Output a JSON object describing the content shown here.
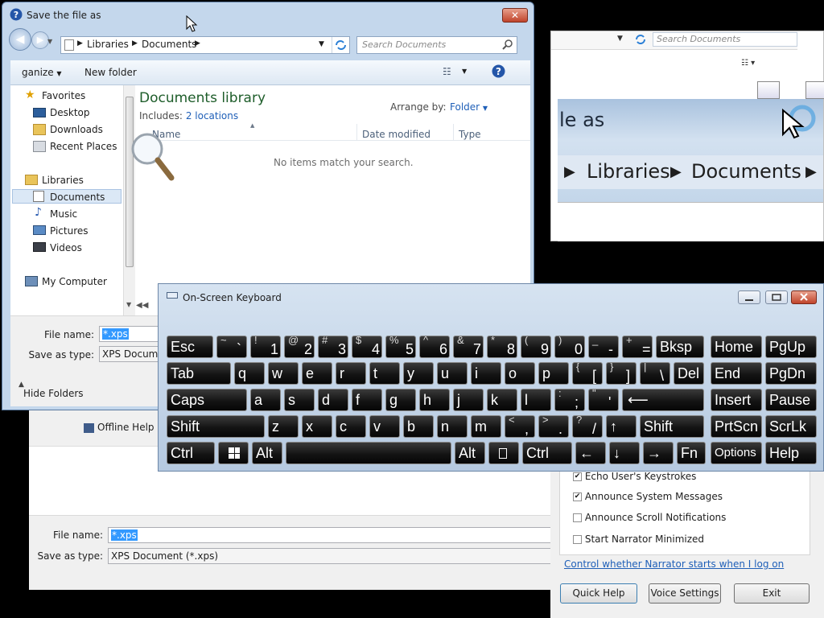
{
  "back_dialog": {
    "offline_help": "Offline Help",
    "file_name_label": "File name:",
    "file_name_value": "*.xps",
    "save_type_label": "Save as type:",
    "save_type_value": "XPS Document (*.xps)"
  },
  "magnifier": {
    "search_placeholder": "Search Documents",
    "zoom_title": "le as",
    "zoom_crumb1": "Libraries",
    "zoom_crumb2": "Documents"
  },
  "narrator": {
    "checkboxes": [
      {
        "label": "Echo User's Keystrokes",
        "checked": true
      },
      {
        "label": "Announce System Messages",
        "checked": true
      },
      {
        "label": "Announce Scroll Notifications",
        "checked": false
      },
      {
        "label": "Start Narrator Minimized",
        "checked": false
      }
    ],
    "link": "Control whether Narrator starts when I log on",
    "quick_help": "Quick Help",
    "voice_settings": "Voice Settings",
    "exit": "Exit"
  },
  "save_dialog": {
    "title": "Save the file as",
    "breadcrumb": [
      "Libraries",
      "Documents"
    ],
    "search_placeholder": "Search Documents",
    "organize": "ganize",
    "new_folder": "New folder",
    "nav": {
      "favorites": "Favorites",
      "desktop": "Desktop",
      "downloads": "Downloads",
      "recent": "Recent Places",
      "libraries": "Libraries",
      "documents": "Documents",
      "music": "Music",
      "pictures": "Pictures",
      "videos": "Videos",
      "computer": "My Computer"
    },
    "library_title": "Documents library",
    "includes_label": "Includes:",
    "includes_link": "2 locations",
    "arrange_label": "Arrange by:",
    "arrange_value": "Folder",
    "columns": [
      "Name",
      "Date modified",
      "Type"
    ],
    "empty_message": "No items match your search.",
    "file_name_label": "File name:",
    "file_name_value": "*.xps",
    "save_type_label": "Save as type:",
    "save_type_value": "XPS Docume",
    "hide_folders": "Hide Folders"
  },
  "keyboard": {
    "title": "On-Screen Keyboard",
    "rows": [
      [
        "Esc",
        "~ `",
        "! 1",
        "@ 2",
        "# 3",
        "$ 4",
        "% 5",
        "^ 6",
        "& 7",
        "* 8",
        "( 9",
        ") 0",
        "_ -",
        "+ =",
        "Bksp",
        "Home",
        "PgUp"
      ],
      [
        "Tab",
        "q",
        "w",
        "e",
        "r",
        "t",
        "y",
        "u",
        "i",
        "o",
        "p",
        "{ [",
        "} ]",
        "| \\",
        "Del",
        "End",
        "PgDn"
      ],
      [
        "Caps",
        "a",
        "s",
        "d",
        "f",
        "g",
        "h",
        "j",
        "k",
        "l",
        ": ;",
        "\" '",
        "Enter",
        "Insert",
        "Pause"
      ],
      [
        "Shift",
        "z",
        "x",
        "c",
        "v",
        "b",
        "n",
        "m",
        "< ,",
        "> .",
        "? /",
        "↑",
        "Shift",
        "PrtScn",
        "ScrLk"
      ],
      [
        "Ctrl",
        "Win",
        "Alt",
        "Space",
        "Alt",
        "Menu",
        "Ctrl",
        "←",
        "↓",
        "→",
        "Fn",
        "Options",
        "Help"
      ]
    ]
  }
}
